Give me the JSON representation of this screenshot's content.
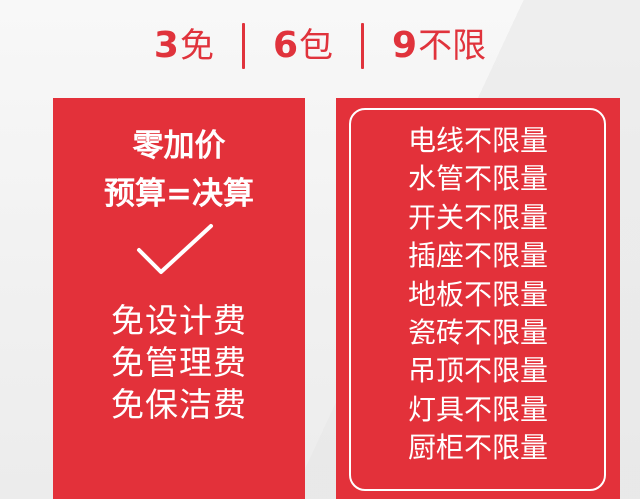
{
  "header": {
    "items": [
      {
        "num": "3",
        "text": "免"
      },
      {
        "num": "6",
        "text": "包"
      },
      {
        "num": "9",
        "text": "不限"
      }
    ]
  },
  "left_card": {
    "title_line1": "零加价",
    "title_line2": "预算=决算",
    "check_icon": "checkmark-icon",
    "items": [
      "免设计费",
      "免管理费",
      "免保洁费"
    ]
  },
  "right_card": {
    "items": [
      "电线不限量",
      "水管不限量",
      "开关不限量",
      "插座不限量",
      "地板不限量",
      "瓷砖不限量",
      "吊顶不限量",
      "灯具不限量",
      "厨柜不限量"
    ]
  },
  "colors": {
    "accent": "#e0333c",
    "card": "#e3313a",
    "text_on_card": "#ffffff",
    "background": "#f2f2f2"
  }
}
